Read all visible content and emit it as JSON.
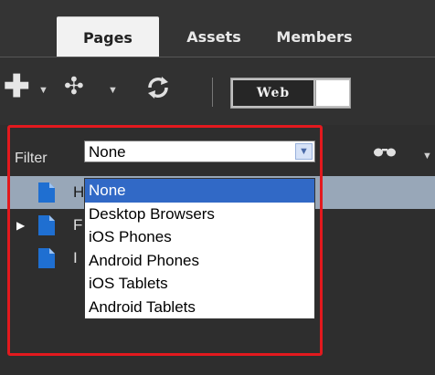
{
  "tabs": [
    {
      "label": "Pages",
      "active": true
    },
    {
      "label": "Assets",
      "active": false
    },
    {
      "label": "Members",
      "active": false
    }
  ],
  "toolbar": {
    "add_icon": "plus-icon",
    "move_icon": "move-arrows-icon",
    "sync_icon": "sync-icon",
    "web_toggle_label": "Web"
  },
  "filter": {
    "label": "Filter",
    "selected_value": "None",
    "options": [
      "None",
      "Desktop Browsers",
      "iOS Phones",
      "Android Phones",
      "iOS Tablets",
      "Android Tablets"
    ],
    "highlighted_option": "None"
  },
  "view_icon": "glasses-icon",
  "tree": {
    "rows": [
      {
        "label": "H",
        "selected": true,
        "expandable": false
      },
      {
        "label": "F",
        "selected": false,
        "expandable": true
      },
      {
        "label": "I",
        "selected": false,
        "expandable": false
      }
    ]
  },
  "colors": {
    "selection_blue": "#3169c6",
    "highlight_red": "#e2191e",
    "tree_selected": "#98a7b8"
  }
}
